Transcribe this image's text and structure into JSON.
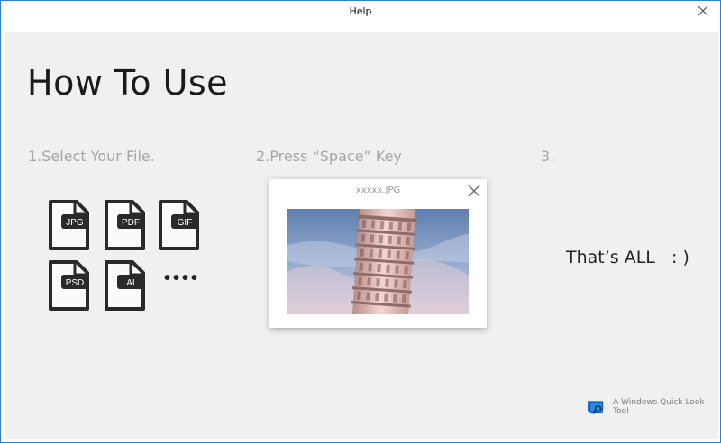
{
  "window": {
    "title": "Help",
    "close_icon": "close-icon"
  },
  "main": {
    "heading": "How To Use",
    "steps": [
      {
        "label": "1.Select Your File."
      },
      {
        "label": "2.Press “Space” Key"
      },
      {
        "label": "3."
      }
    ],
    "file_types": [
      "JPG",
      "PDF",
      "GIF",
      "PSD",
      "AI"
    ],
    "more_indicator": "••••",
    "preview": {
      "filename": "xxxxx.JPG",
      "close_icon": "close-icon",
      "image": "leaning-tower-photo"
    },
    "completion": "That’s ALL   : )"
  },
  "footer": {
    "logo_icon": "app-logo-icon",
    "tagline": "A Windows Quick Look Tool"
  },
  "colors": {
    "window_border": "#2b7fd6",
    "content_bg": "#f0f0f0",
    "step_label": "#a6a6a6",
    "icon_dark": "#2a2a2a",
    "logo_blue": "#1e73d2"
  }
}
